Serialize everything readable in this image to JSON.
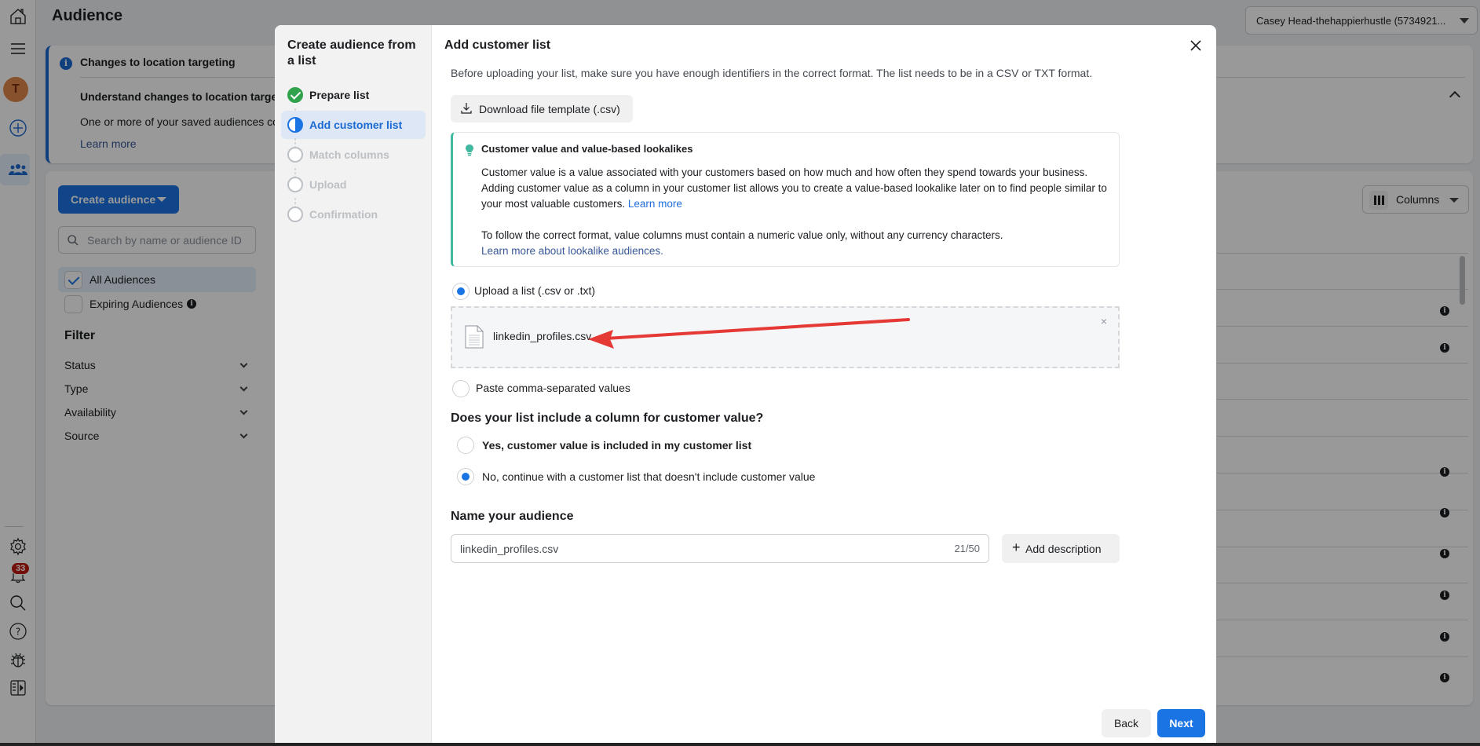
{
  "page": {
    "title": "Audience",
    "account_selector": "Casey Head-thehappierhustle (5734921...",
    "nav": {
      "avatar_initial": "T",
      "notification_count": "33"
    },
    "banner": {
      "title": "Changes to location targeting",
      "subtitle": "Understand changes to location targeting",
      "text": "One or more of your saved audiences co",
      "link": "Learn more"
    },
    "create_audience_label": "Create audience",
    "search_placeholder": "Search by name or audience ID",
    "audience_filters": [
      {
        "label": "All Audiences",
        "checked": true
      },
      {
        "label": "Expiring Audiences",
        "checked": false
      }
    ],
    "filter": {
      "title": "Filter",
      "items": [
        "Status",
        "Type",
        "Availability",
        "Source"
      ]
    },
    "columns_label": "Columns"
  },
  "modal": {
    "sidebar_title": "Create audience from a list",
    "steps": [
      {
        "label": "Prepare list",
        "state": "done"
      },
      {
        "label": "Add customer list",
        "state": "active"
      },
      {
        "label": "Match columns",
        "state": "pending"
      },
      {
        "label": "Upload",
        "state": "pending"
      },
      {
        "label": "Confirmation",
        "state": "pending"
      }
    ],
    "title": "Add customer list",
    "description": "Before uploading your list, make sure you have enough identifiers in the correct format. The list needs to be in a CSV or TXT format.",
    "download_label": "Download file template (.csv)",
    "tip": {
      "title": "Customer value and value-based lookalikes",
      "body": "Customer value is a value associated with your customers based on how much and how often they spend towards your business. Adding customer value as a column in your customer list allows you to create a value-based lookalike later on to find people similar to your most valuable customers.",
      "body_link": "Learn more",
      "body2": "To follow the correct format, value columns must contain a numeric value only, without any currency characters.",
      "body2_link": "Learn more about lookalike audiences."
    },
    "source_options": [
      {
        "label": "Upload a list (.csv or .txt)",
        "selected": true
      },
      {
        "label": "Paste comma-separated values",
        "selected": false
      }
    ],
    "uploaded_file": "linkedin_profiles.csv",
    "remove_file": "×",
    "customer_value_question": "Does your list include a column for customer value?",
    "customer_value_options": [
      {
        "label": "Yes, customer value is included in my customer list",
        "selected": false
      },
      {
        "label": "No, continue with a customer list that doesn't include customer value",
        "selected": true
      }
    ],
    "name_title": "Name your audience",
    "name_value": "linkedin_profiles.csv",
    "name_count": "21/50",
    "add_description_label": "Add description",
    "back_label": "Back",
    "next_label": "Next"
  },
  "annotation": {
    "type": "arrow",
    "color": "#e53935",
    "points_to": "uploaded-file-name"
  },
  "colors": {
    "primary": "#1b74e4",
    "success": "#31a24c",
    "tip_accent": "#42b8a1",
    "badge": "#c0190f"
  }
}
